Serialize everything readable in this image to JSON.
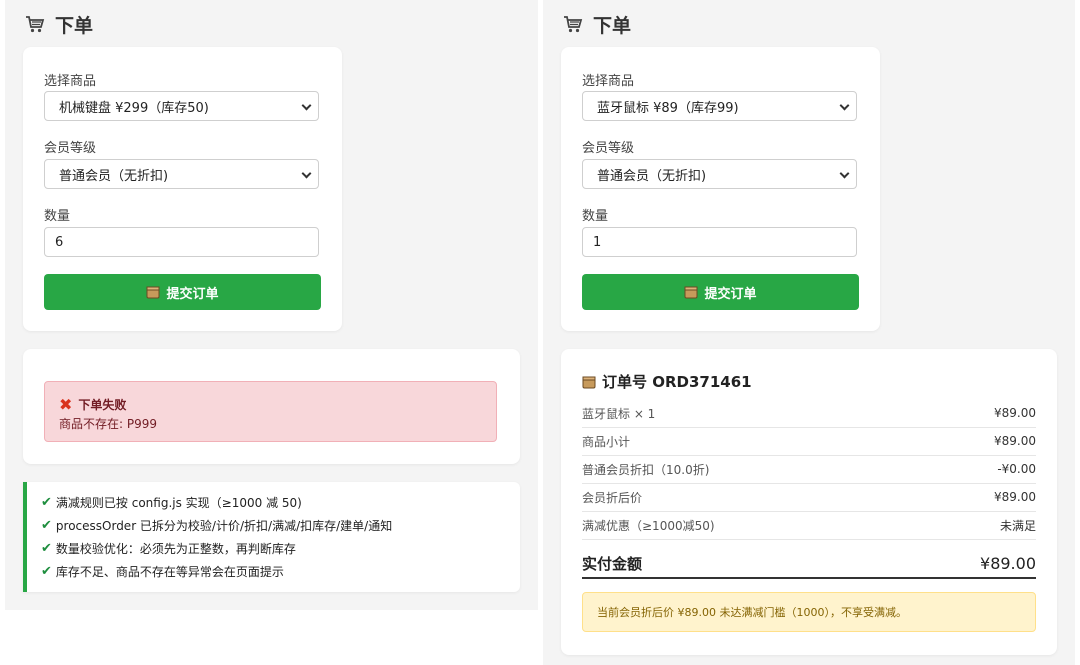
{
  "left": {
    "title": "下单",
    "form": {
      "product_label": "选择商品",
      "product_value": "机械键盘 ¥299（库存50)",
      "member_label": "会员等级",
      "member_value": "普通会员（无折扣)",
      "qty_label": "数量",
      "qty_value": "6",
      "submit_label": "提交订单"
    },
    "error": {
      "title": "下单失败",
      "message": "商品不存在: P999"
    },
    "notes": [
      "满减规则已按 config.js 实现（≥1000 减 50)",
      "processOrder 已拆分为校验/计价/折扣/满减/扣库存/建单/通知",
      "数量校验优化：必须先为正整数，再判断库存",
      "库存不足、商品不存在等异常会在页面提示"
    ]
  },
  "right": {
    "title": "下单",
    "form": {
      "product_label": "选择商品",
      "product_value": "蓝牙鼠标 ¥89（库存99)",
      "member_label": "会员等级",
      "member_value": "普通会员（无折扣)",
      "qty_label": "数量",
      "qty_value": "1",
      "submit_label": "提交订单"
    },
    "order": {
      "title": "订单号 ORD371461",
      "rows": [
        {
          "label": "蓝牙鼠标 × 1",
          "value": "¥89.00"
        },
        {
          "label": "商品小计",
          "value": "¥89.00"
        },
        {
          "label": "普通会员折扣（10.0折)",
          "value": "-¥0.00"
        },
        {
          "label": "会员折后价",
          "value": "¥89.00"
        },
        {
          "label": "满减优惠（≥1000减50)",
          "value": "未满足"
        }
      ],
      "total_label": "实付金额",
      "total_value": "¥89.00",
      "notice": "当前会员折后价 ¥89.00 未达满减门槛（1000），不享受满减。"
    }
  },
  "colors": {
    "submit": "#28a745",
    "error_bg": "#f8d7da",
    "error_text": "#721c24",
    "notice_bg": "#fff3cd",
    "notice_text": "#856404"
  },
  "icons": {
    "title": "cart-icon",
    "submit": "package-icon",
    "error": "x-mark-icon",
    "note": "check-icon",
    "order": "package-icon"
  }
}
